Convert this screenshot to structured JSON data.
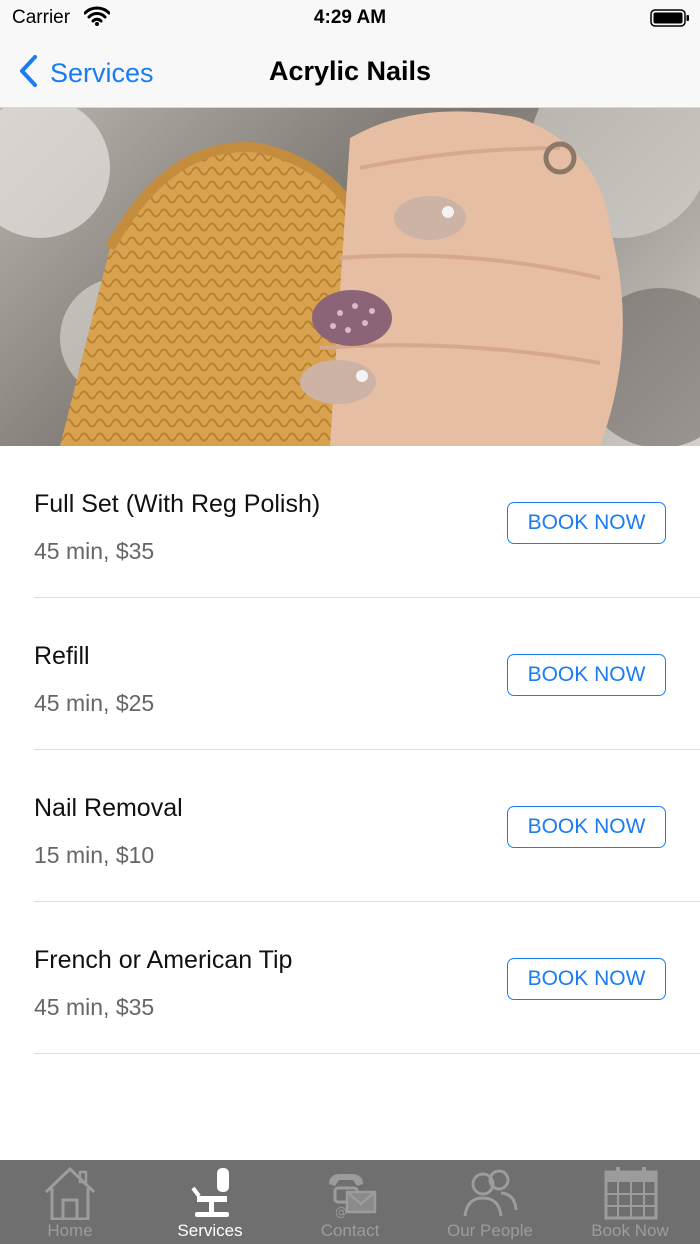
{
  "status_bar": {
    "carrier": "Carrier",
    "time": "4:29 AM"
  },
  "nav": {
    "back_label": "Services",
    "title": "Acrylic Nails"
  },
  "hero": {
    "subject": "manicured hand with glitter acrylic nails holding a mustard knit sweater"
  },
  "services": [
    {
      "name": "Full Set (With Reg Polish)",
      "meta": "45 min, $35",
      "button": "BOOK NOW"
    },
    {
      "name": "Refill",
      "meta": "45 min, $25",
      "button": "BOOK NOW"
    },
    {
      "name": "Nail Removal",
      "meta": "15 min, $10",
      "button": "BOOK NOW"
    },
    {
      "name": "French or American Tip",
      "meta": "45 min, $35",
      "button": "BOOK NOW"
    }
  ],
  "tabs": [
    {
      "label": "Home",
      "icon": "home-icon",
      "active": false
    },
    {
      "label": "Services",
      "icon": "salon-chair-icon",
      "active": true
    },
    {
      "label": "Contact",
      "icon": "phone-envelope-icon",
      "active": false
    },
    {
      "label": "Our People",
      "icon": "people-icon",
      "active": false
    },
    {
      "label": "Book Now",
      "icon": "calendar-icon",
      "active": false
    }
  ],
  "colors": {
    "accent": "#1a7cf2",
    "tab_bar_bg": "#6f6f6f",
    "tab_inactive": "#9c9c9c",
    "tab_active": "#ffffff"
  }
}
